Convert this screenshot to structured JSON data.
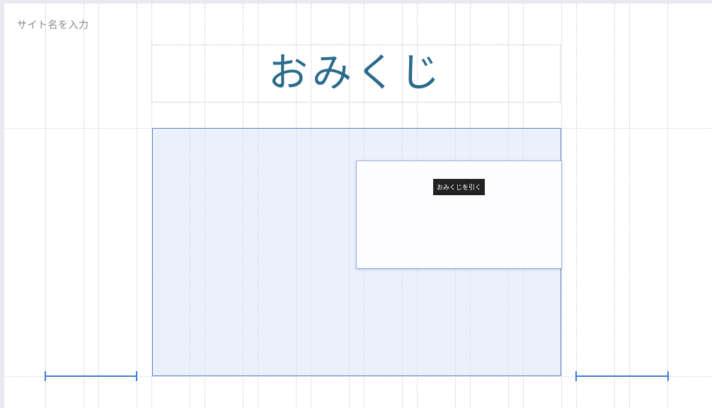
{
  "site": {
    "name_placeholder": "サイト名を入力"
  },
  "page": {
    "title": "おみくじ"
  },
  "omikuji": {
    "draw_button_label": "おみくじを引く"
  },
  "colors": {
    "title": "#2a6b8c",
    "accent": "#3c7ad6",
    "button_bg": "#222222",
    "button_text": "#ffffff"
  }
}
